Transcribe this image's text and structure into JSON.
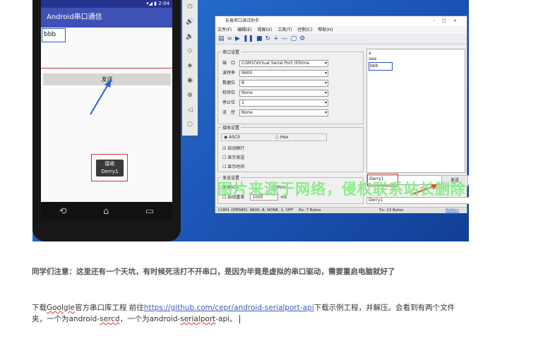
{
  "phone": {
    "status_time": "2:04",
    "app_title": "Android串口通信",
    "input_value": "bbb",
    "send_label": "发送",
    "toast_line1": "接收",
    "toast_line2": "Derry1"
  },
  "emulator_toolbar": {
    "icons": [
      "power-icon",
      "volume-up-icon",
      "volume-down-icon",
      "rotate-left-icon",
      "rotate-right-icon",
      "camera-icon",
      "zoom-icon",
      "back-icon",
      "home-icon",
      "overview-icon",
      "more-icon"
    ]
  },
  "serial_tool": {
    "title": "友善串口调试助手",
    "menu": [
      "文件(F)",
      "编辑(E)",
      "视图(V)",
      "工具(T)",
      "控制(C)",
      "帮助(H)"
    ],
    "serial_group": "串口设置",
    "rows": [
      {
        "label": "端　口",
        "value": "COM1(Virtual Serial Port (Eltima"
      },
      {
        "label": "波特率",
        "value": "9600"
      },
      {
        "label": "数据位",
        "value": "8"
      },
      {
        "label": "校验位",
        "value": "None"
      },
      {
        "label": "停止位",
        "value": "1"
      },
      {
        "label": "流　控",
        "value": "None"
      }
    ],
    "receive_group": "接收设置",
    "rx_ascii": "ASCII",
    "rx_hex": "Hex",
    "auto_newline": "自动换行",
    "show_send": "显示发送",
    "show_time": "显示时间",
    "send_group": "发送设置",
    "tx_ascii": "ASCII",
    "tx_hex": "Hex",
    "auto_resend": "自动重发",
    "resend_interval": "1000",
    "resend_unit": "ms",
    "receive_lines": [
      "a",
      "aaa",
      "bbb"
    ],
    "send_value": "Derry1",
    "send_button": "发送",
    "history_value": "Derry1",
    "status_port": "COM1 OPENED, 9600, 8, NONE, 1, OFF",
    "status_rx": "Rx: 7 Bytes",
    "status_tx": "Tx: 13 Bytes",
    "status_link": "Addion"
  },
  "watermark": "图片来源于网络，侵权联系站长删除！",
  "article": {
    "note": "同学们注意：这里还有一个天坑，有时候死活打不开串口，是因为毕竟是虚拟的串口驱动，需要重启电脑就好了",
    "p_prefix": "下载",
    "p_googlle": "Goolgle",
    "p_mid": "官方串口库工程 前往",
    "p_link": "https://github.com/cepr/android-serialport-api",
    "p_after_link": "下载示例工程，并解压。会看到有两个文件夹，一个为android-",
    "p_sercd": "sercd",
    "p_mid2": "，一个为android-",
    "p_serialport": "serialport",
    "p_end": "-api。"
  }
}
